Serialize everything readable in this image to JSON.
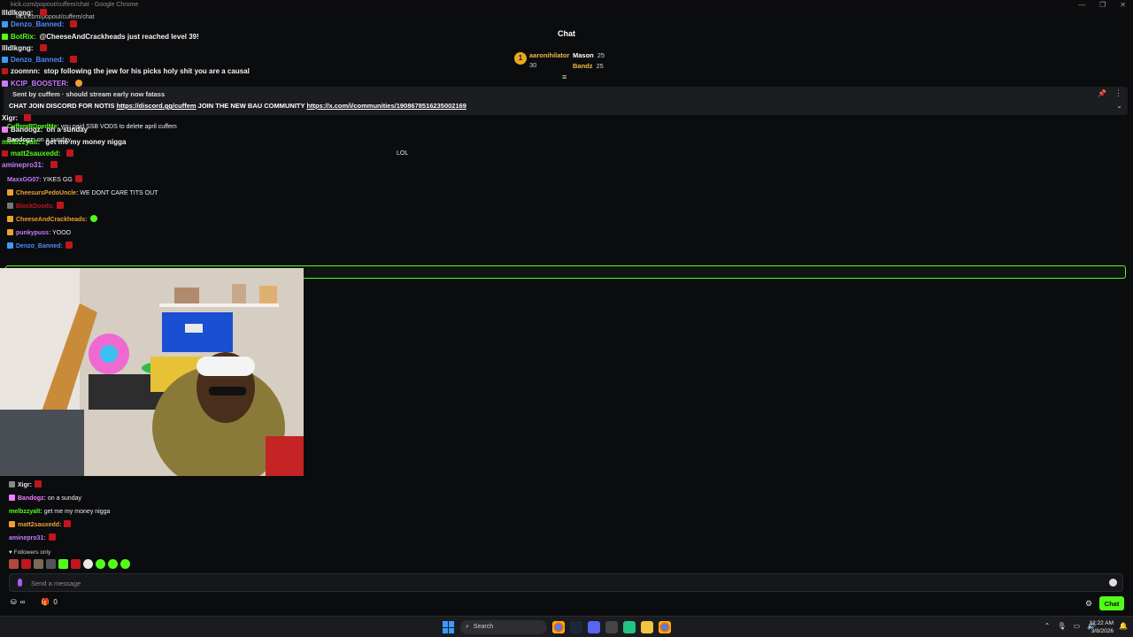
{
  "browser": {
    "title": "kick.com/popout/cuffem/chat - Google Chrome",
    "url": "kick.com/popout/cuffem/chat",
    "controls": [
      "—",
      "❐",
      "✕"
    ]
  },
  "bg_chat": [
    {
      "user": "llldlkgng:",
      "text": "",
      "user_color": "#f2f2f2",
      "emote": "r"
    },
    {
      "user": "Denzo_Banned:",
      "text": "",
      "user_color": "#4a8cff",
      "emote": "r"
    },
    {
      "user": "BotRix:",
      "text": "@CheeseAndCrackheads just reached level 39!",
      "user_color": "#53fc18",
      "emote": ""
    },
    {
      "user": "llldlkgng:",
      "text": "",
      "user_color": "#f2f2f2",
      "emote": "r"
    },
    {
      "user": "Denzo_Banned:",
      "text": "",
      "user_color": "#4a8cff",
      "emote": "r"
    },
    {
      "user": "zoomnn:",
      "text": "stop following the jew for his picks holy shit you are a causal",
      "user_color": "#f2f2f2",
      "emote": ""
    },
    {
      "user": "KCIP_BOOSTER:",
      "text": "",
      "user_color": "#c87cff",
      "emote": "o"
    },
    {
      "user": "",
      "text": "should stream early now fatass",
      "user_color": "#f2f2f2",
      "emote": ""
    }
  ],
  "chat": {
    "title": "Chat",
    "leaderboard": {
      "first": {
        "rank": "1",
        "name": "aaronihilator",
        "score": "30"
      },
      "second": {
        "name": "Mason",
        "score": "25"
      },
      "third": {
        "name": "Bandz",
        "score": "25"
      }
    }
  },
  "pinned": {
    "author_line": "Sent by cuffem",
    "prefix": "CHAT",
    "text": "JOIN DISCORD FOR NOTIS",
    "link1": "https://discord.gg/cuffem",
    "middle": "JOIN THE NEW BAU COMMUNITY",
    "link2": "https://x.com/i/communities/1908678516235002169"
  },
  "mid_chat": [
    {
      "user": "Xigr:",
      "text": "",
      "color": "#f2f2f2"
    },
    {
      "user": "Bandogz:",
      "text": "on a sunday",
      "color": "#f2f2f2"
    },
    {
      "user": "melbzzyalt:",
      "text": "get me my money nigga",
      "color": "#53fc18"
    },
    {
      "user": "matt2sauxedd:",
      "text": "",
      "color": "#53fc18"
    },
    {
      "user": "aminepro31:",
      "text": "",
      "color": "#c87cff"
    }
  ],
  "inner_chat": [
    {
      "user": "CuffemRDpedMe:",
      "text": "you paid SSB VODS to delete april cuffem",
      "color": "#53fc18"
    },
    {
      "user": "Bandogz:",
      "text": "on a sunday",
      "color": "#f2f2f2"
    },
    {
      "user": "",
      "text": "LOL",
      "color": "#f2f2f2"
    },
    {
      "user": "",
      "text": "",
      "color": "#f2f2f2"
    },
    {
      "user": "MaxxGG07:",
      "text": "YIKES GG",
      "color": "#c87cff"
    },
    {
      "user": "CheesursPedoUncle:",
      "text": "WE DONT CARE TITS OUT",
      "color": "#f0a030"
    },
    {
      "user": "BlockDoods:",
      "text": "",
      "color": "#c0161c"
    },
    {
      "user": "CheeseAndCrackheads:",
      "text": "",
      "color": "#f0a030"
    },
    {
      "user": "punkypuss:",
      "text": "YOOO",
      "color": "#c87cff"
    },
    {
      "user": "Denzo_Banned:",
      "text": "",
      "color": "#4a8cff"
    }
  ],
  "low_chat": [
    {
      "user": "Xigr:",
      "text": "",
      "color": "#f2f2f2"
    },
    {
      "user": "Bandogz:",
      "text": "on a sunday",
      "color": "#f27cff"
    },
    {
      "user": "melbzzyalt:",
      "text": "get me my money nigga",
      "color": "#53fc18"
    },
    {
      "user": "matt2sauxedd:",
      "text": "",
      "color": "#f0a030"
    },
    {
      "user": "aminepro31:",
      "text": "",
      "color": "#c87cff"
    }
  ],
  "followers_only": "Followers only",
  "input": {
    "placeholder": "Send a message"
  },
  "bottom": {
    "points": "∞",
    "gifts": "0",
    "chat_button": "Chat"
  },
  "taskbar": {
    "search": "Search",
    "time": "12:22 AM",
    "date": "3/8/2026"
  }
}
